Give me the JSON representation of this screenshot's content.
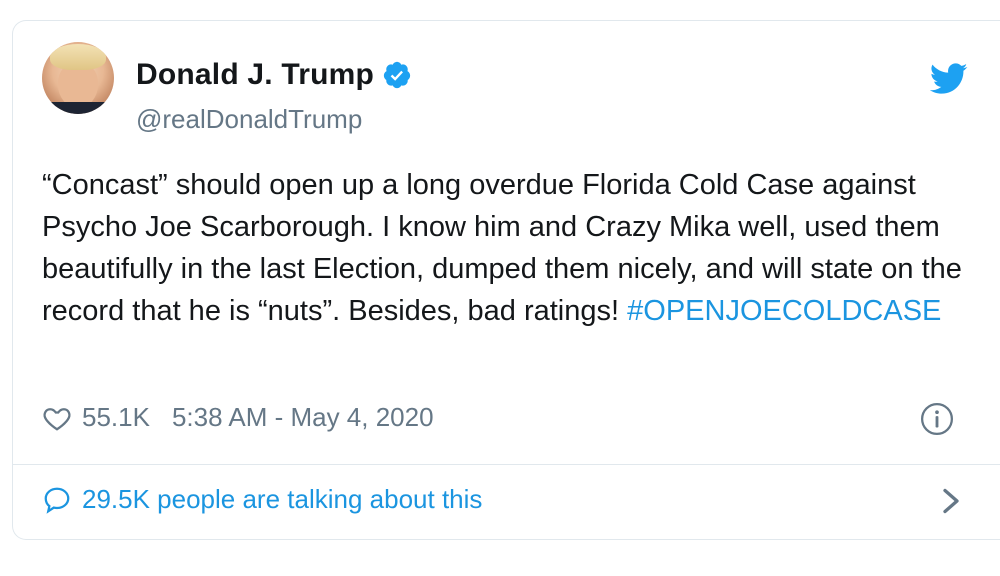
{
  "author": {
    "name": "Donald J. Trump",
    "handle": "@realDonaldTrump",
    "verified_icon": "verified-badge-icon",
    "verified_color": "#1da1f2"
  },
  "tweet": {
    "text": "“Concast” should open up a long overdue Florida Cold Case against Psycho Joe Scarborough. I know him and Crazy Mika well, used them beautifully in the last Election, dumped them nicely, and will state on the record that he is “nuts”. Besides, bad ratings! ",
    "hashtag": "#OPENJOECOLDCASE"
  },
  "meta": {
    "likes": "55.1K",
    "timestamp": "5:38 AM - May 4, 2020"
  },
  "footer": {
    "talking": "29.5K people are talking about this"
  },
  "colors": {
    "accent": "#1b95e0",
    "secondary_text": "#657786",
    "border": "#e1e8ed"
  }
}
